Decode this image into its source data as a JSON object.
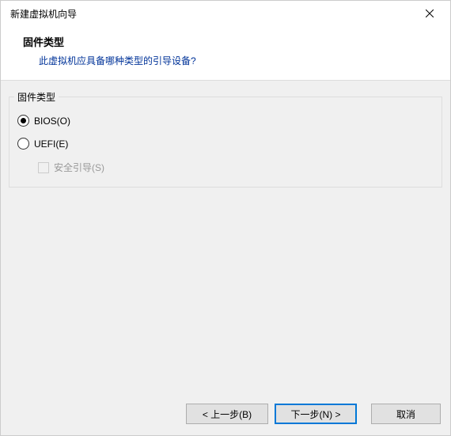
{
  "window": {
    "title": "新建虚拟机向导"
  },
  "header": {
    "heading": "固件类型",
    "subheading": "此虚拟机应具备哪种类型的引导设备?"
  },
  "group": {
    "legend": "固件类型",
    "options": {
      "bios": "BIOS(O)",
      "uefi": "UEFI(E)",
      "secureBoot": "安全引导(S)"
    }
  },
  "footer": {
    "back": "< 上一步(B)",
    "next": "下一步(N) >",
    "cancel": "取消"
  }
}
